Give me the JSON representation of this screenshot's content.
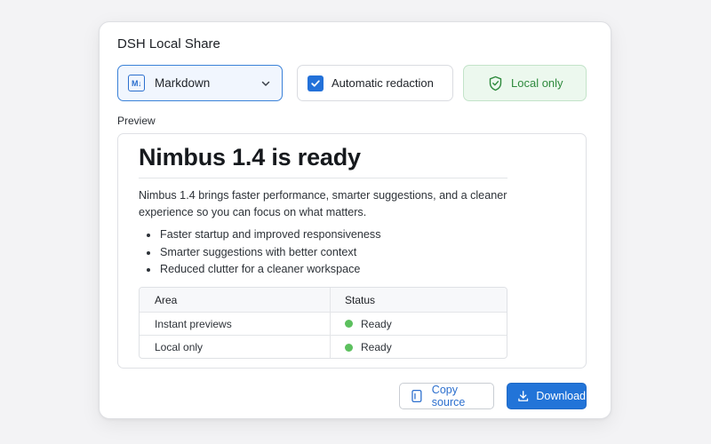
{
  "dialog": {
    "title": "DSH Local Share"
  },
  "options": {
    "format": {
      "icon": "markdown-icon",
      "icon_text": "M↓",
      "label": "Markdown"
    },
    "redaction": {
      "label": "Automatic redaction",
      "checked": true
    },
    "local": {
      "icon": "shield-check-icon",
      "label": "Local only"
    }
  },
  "preview": {
    "label": "Preview",
    "title": "Nimbus 1.4 is ready",
    "paragraph": "Nimbus 1.4 brings faster performance, smarter suggestions, and a cleaner experience so you can focus on what matters.",
    "bullets": [
      "Faster startup and improved responsiveness",
      "Smarter suggestions with better context",
      "Reduced clutter for a cleaner workspace"
    ],
    "table": {
      "headers": [
        "Area",
        "Status"
      ],
      "rows": [
        [
          "Instant previews",
          "Ready"
        ],
        [
          "Local only",
          "Ready"
        ]
      ]
    }
  },
  "actions": {
    "copy": {
      "icon": "copy-icon",
      "label": "Copy source"
    },
    "download": {
      "icon": "download-icon",
      "label": "Download"
    }
  },
  "colors": {
    "accent": "#2274d8",
    "success": "#2e8a3d",
    "status_dot": "#5cc05e"
  }
}
